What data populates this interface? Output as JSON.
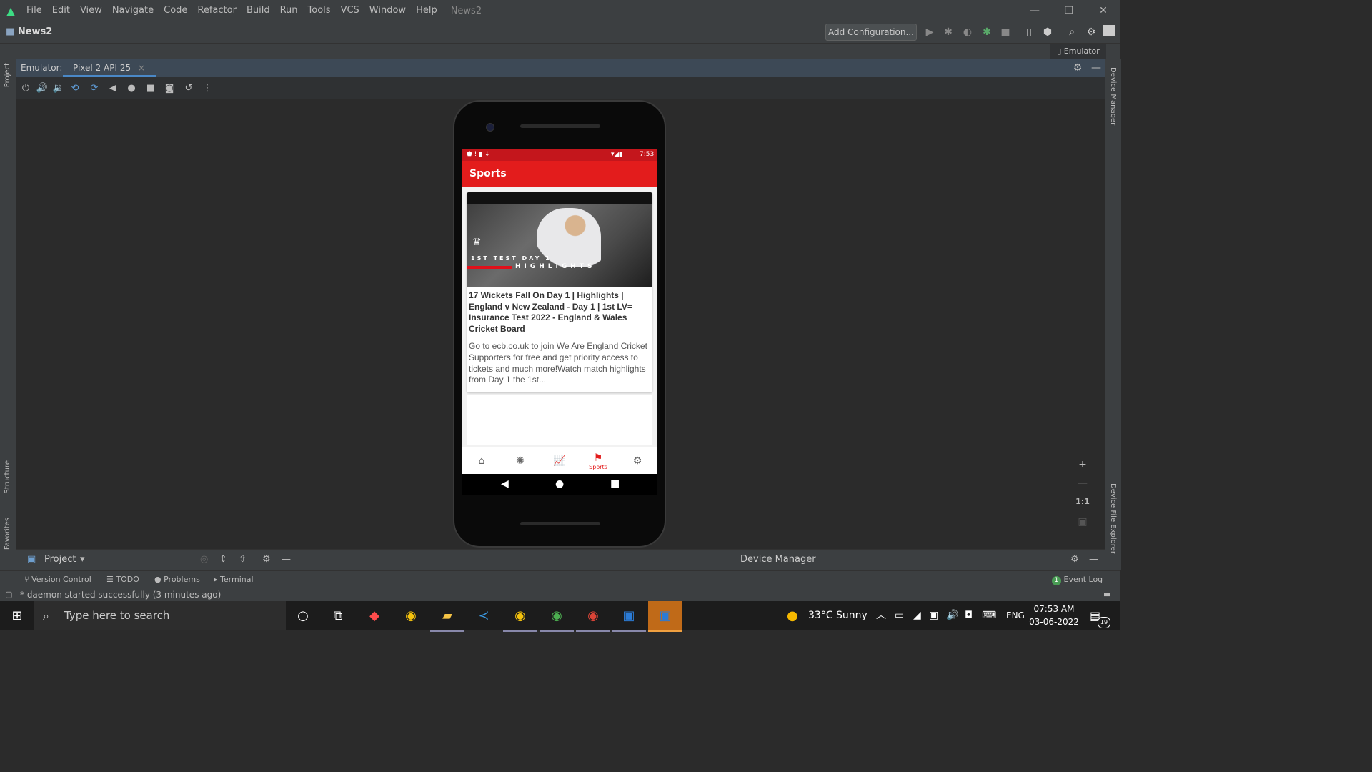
{
  "window": {
    "menu": [
      "File",
      "Edit",
      "View",
      "Navigate",
      "Code",
      "Refactor",
      "Build",
      "Run",
      "Tools",
      "VCS",
      "Window",
      "Help"
    ],
    "project_name_title": "News2",
    "minimize": "—",
    "restore": "❐",
    "close": "✕"
  },
  "navbar": {
    "project": "News2",
    "add_config": "Add Configuration..."
  },
  "emulator": {
    "side_button": "Emulator",
    "label": "Emulator:",
    "device_tab": "Pixel 2 API 25",
    "zoom": {
      "plus": "+",
      "minus": "—",
      "one_to_one": "1:1"
    }
  },
  "left_strip": {
    "project": "Project",
    "structure": "Structure",
    "favorites": "Favorites"
  },
  "right_strip": {
    "device_manager": "Device Manager",
    "device_file_explorer": "Device File Explorer"
  },
  "phone": {
    "status_time": "7:53",
    "app_title": "Sports",
    "thumbnail": {
      "line1": "1ST TEST DAY 1",
      "line2": "HIGHLIGHTS"
    },
    "article": {
      "title": "17 Wickets Fall On Day 1 | Highlights | England v New Zealand - Day 1 | 1st LV= Insurance Test 2022 - England & Wales Cricket Board",
      "description": "Go to ecb.co.uk to join We Are England Cricket Supporters for free and get priority access to tickets and much more!Watch match highlights from Day 1 the 1st..."
    },
    "bottom_nav_active_label": "Sports"
  },
  "bottom_panels": {
    "project": "Project",
    "device_manager": "Device Manager"
  },
  "tool_tabs": {
    "version_control": "Version Control",
    "todo": "TODO",
    "problems": "Problems",
    "terminal": "Terminal",
    "event_log": "Event Log",
    "event_count": "1"
  },
  "status_message": "* daemon started successfully (3 minutes ago)",
  "taskbar": {
    "search_placeholder": "Type here to search",
    "weather": "33°C  Sunny",
    "language": "ENG",
    "time": "07:53 AM",
    "date": "03-06-2022",
    "notifications": "19"
  },
  "colors": {
    "accent_red": "#e31c1c",
    "ide_bg": "#2b2b2b",
    "ide_panel": "#3c3f41",
    "tab_underline": "#4a88c7"
  }
}
